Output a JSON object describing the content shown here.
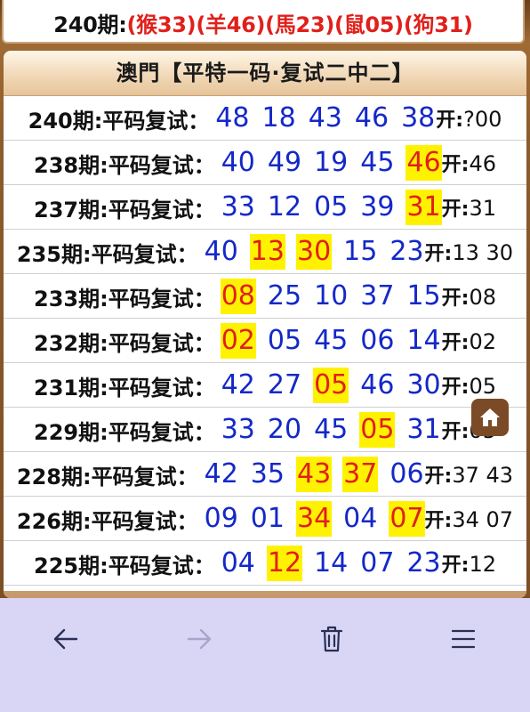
{
  "top": {
    "prefix": "240期:",
    "zodiac": "(猴33)(羊46)(馬23)(鼠05)(狗31)"
  },
  "panel": {
    "title": "澳門【平特一码·复试二中二】",
    "rows": [
      {
        "label": "240期:平码复试：",
        "nums": [
          {
            "n": "48",
            "hit": false
          },
          {
            "n": "18",
            "hit": false
          },
          {
            "n": "43",
            "hit": false
          },
          {
            "n": "46",
            "hit": false
          },
          {
            "n": "38",
            "hit": false
          }
        ],
        "res_label": "开:",
        "res_value": "?00"
      },
      {
        "label": "238期:平码复试：",
        "nums": [
          {
            "n": "40",
            "hit": false
          },
          {
            "n": "49",
            "hit": false
          },
          {
            "n": "19",
            "hit": false
          },
          {
            "n": "45",
            "hit": false
          },
          {
            "n": "46",
            "hit": true
          }
        ],
        "res_label": "开:",
        "res_value": "46"
      },
      {
        "label": "237期:平码复试：",
        "nums": [
          {
            "n": "33",
            "hit": false
          },
          {
            "n": "12",
            "hit": false
          },
          {
            "n": "05",
            "hit": false
          },
          {
            "n": "39",
            "hit": false
          },
          {
            "n": "31",
            "hit": true
          }
        ],
        "res_label": "开:",
        "res_value": "31"
      },
      {
        "label": "235期:平码复试：",
        "nums": [
          {
            "n": "40",
            "hit": false
          },
          {
            "n": "13",
            "hit": true
          },
          {
            "n": "30",
            "hit": true
          },
          {
            "n": "15",
            "hit": false
          },
          {
            "n": "23",
            "hit": false
          }
        ],
        "res_label": "开:",
        "res_value": "13 30"
      },
      {
        "label": "233期:平码复试：",
        "nums": [
          {
            "n": "08",
            "hit": true
          },
          {
            "n": "25",
            "hit": false
          },
          {
            "n": "10",
            "hit": false
          },
          {
            "n": "37",
            "hit": false
          },
          {
            "n": "15",
            "hit": false
          }
        ],
        "res_label": "开:",
        "res_value": "08"
      },
      {
        "label": "232期:平码复试：",
        "nums": [
          {
            "n": "02",
            "hit": true
          },
          {
            "n": "05",
            "hit": false
          },
          {
            "n": "45",
            "hit": false
          },
          {
            "n": "06",
            "hit": false
          },
          {
            "n": "14",
            "hit": false
          }
        ],
        "res_label": "开:",
        "res_value": "02"
      },
      {
        "label": "231期:平码复试：",
        "nums": [
          {
            "n": "42",
            "hit": false
          },
          {
            "n": "27",
            "hit": false
          },
          {
            "n": "05",
            "hit": true
          },
          {
            "n": "46",
            "hit": false
          },
          {
            "n": "30",
            "hit": false
          }
        ],
        "res_label": "开:",
        "res_value": "05"
      },
      {
        "label": "229期:平码复试：",
        "nums": [
          {
            "n": "33",
            "hit": false
          },
          {
            "n": "20",
            "hit": false
          },
          {
            "n": "45",
            "hit": false
          },
          {
            "n": "05",
            "hit": true
          },
          {
            "n": "31",
            "hit": false
          }
        ],
        "res_label": "开:",
        "res_value": "05"
      },
      {
        "label": "228期:平码复试：",
        "nums": [
          {
            "n": "42",
            "hit": false
          },
          {
            "n": "35",
            "hit": false
          },
          {
            "n": "43",
            "hit": true
          },
          {
            "n": "37",
            "hit": true
          },
          {
            "n": "06",
            "hit": false
          }
        ],
        "res_label": "开:",
        "res_value": "37 43"
      },
      {
        "label": "226期:平码复试：",
        "nums": [
          {
            "n": "09",
            "hit": false
          },
          {
            "n": "01",
            "hit": false
          },
          {
            "n": "34",
            "hit": true
          },
          {
            "n": "04",
            "hit": false
          },
          {
            "n": "07",
            "hit": true
          }
        ],
        "res_label": "开:",
        "res_value": "34 07"
      },
      {
        "label": "225期:平码复试：",
        "nums": [
          {
            "n": "04",
            "hit": false
          },
          {
            "n": "12",
            "hit": true
          },
          {
            "n": "14",
            "hit": false
          },
          {
            "n": "07",
            "hit": false
          },
          {
            "n": "23",
            "hit": false
          }
        ],
        "res_label": "开:",
        "res_value": "12"
      }
    ]
  },
  "floating": {
    "home_icon": "home-icon"
  },
  "navbar": {
    "icons": [
      "back-arrow-icon",
      "forward-arrow-icon",
      "trash-icon",
      "menu-icon"
    ],
    "forward_disabled": true
  },
  "colors": {
    "number": "#1428c8",
    "hit_text": "#e0201b",
    "hit_bg": "#fff200",
    "zodiac": "#e0201b"
  }
}
